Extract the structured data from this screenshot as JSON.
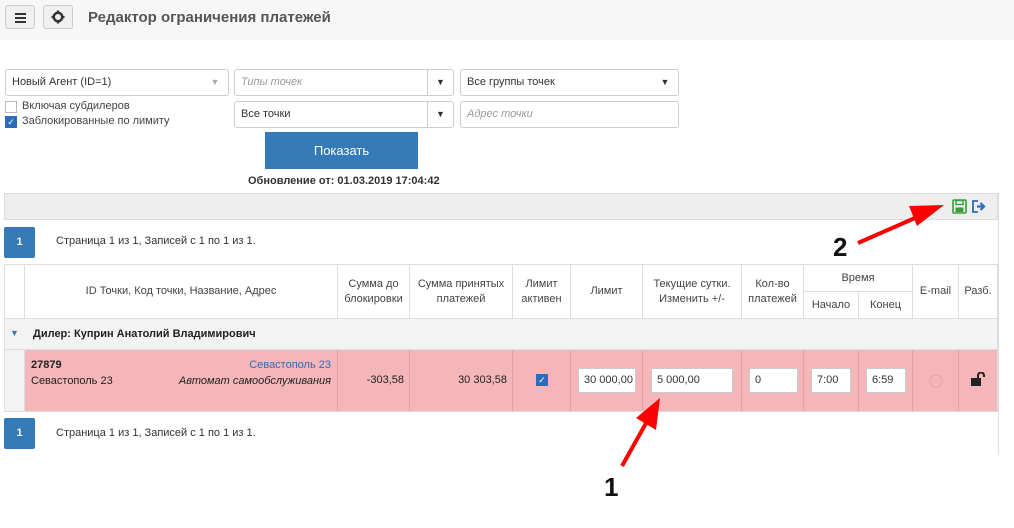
{
  "header": {
    "title": "Редактор ограничения платежей"
  },
  "filters": {
    "agent": "Новый Агент (ID=1)",
    "point_types_placeholder": "Типы точек",
    "point_groups": "Все группы точек",
    "points": "Все точки",
    "address_placeholder": "Адрес точки",
    "include_subdealers": "Включая субдилеров",
    "blocked_by_limit": "Заблокированные по лимиту",
    "show_button": "Показать",
    "updated": "Обновление от: 01.03.2019 17:04:42"
  },
  "pager": {
    "page": "1",
    "info": "Страница 1 из 1, Записей с 1 по 1 из 1."
  },
  "columns": {
    "id": "ID Точки,  Код точки,  Название,  Адрес",
    "sum_before_block": "Сумма до блокировки",
    "sum_accepted": "Сумма принятых платежей",
    "limit_active": "Лимит активен",
    "limit": "Лимит",
    "current_day": "Текущие сутки. Изменить +/-",
    "payments_count": "Кол-во платежей",
    "time": "Время",
    "time_start": "Начало",
    "time_end": "Конец",
    "email": "E-mail",
    "unlock": "Разб."
  },
  "group": {
    "label": "Дилер: Куприн Анатолий Владимирович"
  },
  "row": {
    "id": "27879",
    "city": "Севастополь 23",
    "link": "Севастополь 23",
    "type": "Автомат самообслуживания",
    "sum_before_block": "-303,58",
    "sum_accepted": "30 303,58",
    "limit": "30 000,00",
    "current_day": "5 000,00",
    "payments_count": "0",
    "time_start": "7:00",
    "time_end": "6:59"
  },
  "annotations": {
    "a1": "1",
    "a2": "2"
  }
}
